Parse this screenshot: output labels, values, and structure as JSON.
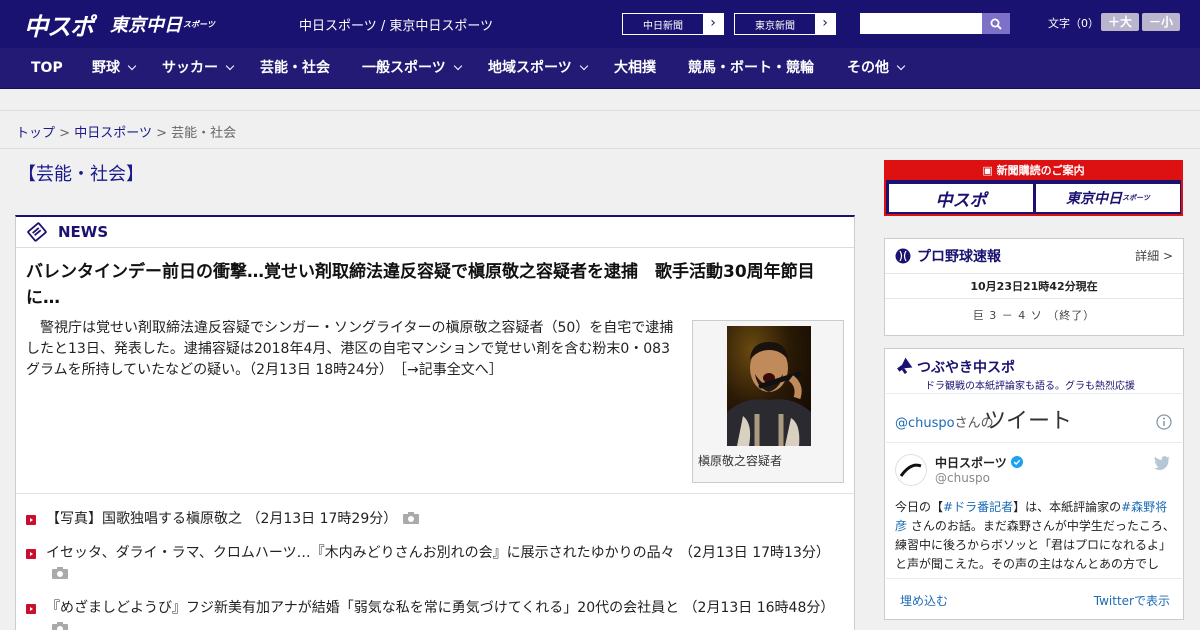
{
  "header": {
    "logo_chuspo": "中スポ",
    "logo_tokyo": "東京中日",
    "logo_tokyo_sub": "スポーツ",
    "site_title": "中日スポーツ / 東京中日スポーツ",
    "links": [
      "中日新聞",
      "東京新聞"
    ],
    "search_placeholder": "",
    "font_size_label": "文字（0）",
    "font_larger": "＋大",
    "font_smaller": "－小",
    "colors": {
      "header_bg": "#1a1270",
      "nav_bg": "#231a76",
      "accent_red": "#c8102e"
    }
  },
  "nav": [
    {
      "label": "TOP"
    },
    {
      "label": "野球"
    },
    {
      "label": "サッカー"
    },
    {
      "label": "芸能・社会"
    },
    {
      "label": "一般スポーツ"
    },
    {
      "label": "地域スポーツ"
    },
    {
      "label": "大相撲"
    },
    {
      "label": "競馬・ボート・競輪"
    },
    {
      "label": "その他"
    }
  ],
  "breadcrumb": {
    "top": "トップ",
    "sep": ">",
    "section": "中日スポーツ",
    "current": "芸能・社会"
  },
  "page_title": "【芸能・社会】",
  "news": {
    "label": "NEWS",
    "headline": "バレンタインデー前日の衝撃…覚せい剤取締法違反容疑で槇原敬之容疑者を逮捕　歌手活動30周年節目に…",
    "summary": "警視庁は覚せい剤取締法違反容疑でシンガー・ソングライターの槇原敬之容疑者（50）を自宅で逮捕したと13日、発表した。逮捕容疑は2018年4月、港区の自宅マンションで覚せい剤を含む粉末0・083グラムを所持していたなどの疑い。（2月13日 18時24分）　［→記事全文へ］",
    "photo_caption": "槇原敬之容疑者",
    "list": [
      {
        "text": "【写真】国歌独唱する槇原敬之 （2月13日 17時29分）"
      },
      {
        "text": "イセッタ、ダライ・ラマ、クロムハーツ…『木内みどりさんお別れの会』に展示されたゆかりの品々 （2月13日 17時13分）"
      },
      {
        "text": "『めざましどようび』フジ新美有加アナが結婚「弱気な私を常に勇気づけてくれる」20代の会社員と （2月13日 16時48分）"
      }
    ]
  },
  "sidebar": {
    "ad_banner": {
      "title": "新聞購読のご案内",
      "logo1": "中スポ",
      "logo2": "東京中日",
      "logo2_sub": "スポーツ"
    },
    "baseball": {
      "title": "プロ野球速報",
      "detail": "詳細 >",
      "time": "10月23日21時42分現在",
      "score": "巨 3 － 4 ソ （終了）"
    },
    "twitter": {
      "title": "つぶやき中スポ",
      "subtitle": "ドラ観戦の本紙評論家も語る。グラも熱烈応援",
      "handle": "@chuspo",
      "handle_suffix": "さんの",
      "tweet_label": "ツイート",
      "account_name": "中日スポーツ",
      "account_user": "@chuspo",
      "tweet_text_1": "今日の【",
      "tweet_tag_1": "#ドラ番記者",
      "tweet_text_2": "】は、本紙評論家の",
      "tweet_tag_2": "#森野将彦",
      "tweet_text_3": " さんのお話。まだ森野さんが中学生だったころ、練習中に後ろからボソッと「君はプロになれるよ」と声が聞こえた。その声の主はなんとあの方でし",
      "embed_label": "埋め込む",
      "view_label": "Twitterで表示"
    }
  }
}
